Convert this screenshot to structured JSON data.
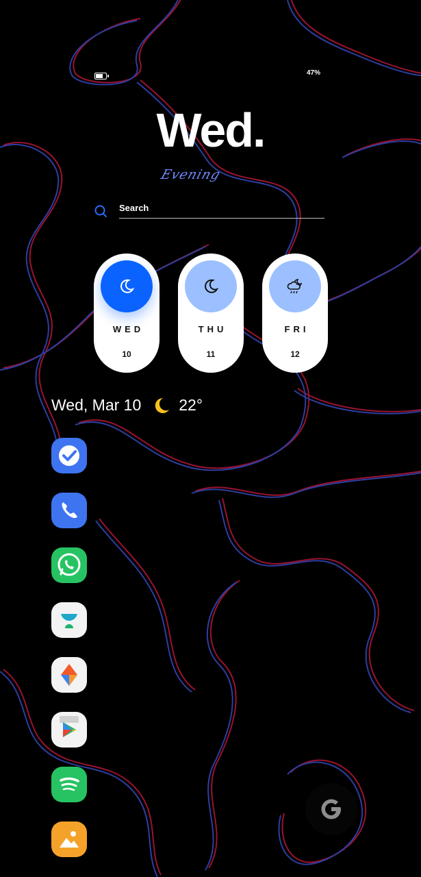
{
  "status": {
    "battery_text": "47%",
    "battery_level": 0.47
  },
  "header": {
    "day_title": "Wed.",
    "greeting": "Evening"
  },
  "search": {
    "label": "Search"
  },
  "forecast": [
    {
      "day": "WED",
      "date": "10",
      "icon": "moon-icon",
      "active": true
    },
    {
      "day": "THU",
      "date": "11",
      "icon": "moon-icon",
      "active": false
    },
    {
      "day": "FRI",
      "date": "12",
      "icon": "cloud-rain-moon-icon",
      "active": false
    }
  ],
  "info": {
    "date_text": "Wed, Mar 10",
    "weather_icon": "crescent-moon-icon",
    "temperature": "22°"
  },
  "dock_apps": [
    {
      "name": "tasks-app",
      "icon": "checkmark-icon",
      "color": "#3f74f1"
    },
    {
      "name": "phone-app",
      "icon": "phone-icon",
      "color": "#3f74f1"
    },
    {
      "name": "whatsapp-app",
      "icon": "whatsapp-icon",
      "color": "#27c363"
    },
    {
      "name": "dock-style-app",
      "icon": "teal-dock-icon",
      "color": "#f3f3f3"
    },
    {
      "name": "orange-arrow-app",
      "icon": "orange-blue-arrow-icon",
      "color": "#f3f3f3"
    },
    {
      "name": "play-store-app",
      "icon": "play-store-icon",
      "color": "#f3f3f3"
    },
    {
      "name": "spotify-app",
      "icon": "spotify-icon",
      "color": "#27c363"
    },
    {
      "name": "gallery-app",
      "icon": "image-icon",
      "color": "#f5a22a"
    }
  ],
  "colors": {
    "accent_blue": "#0a63ff",
    "light_blue": "#9cc0ff",
    "greeting": "#6f8cff"
  }
}
